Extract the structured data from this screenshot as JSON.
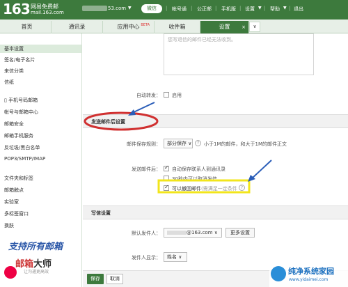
{
  "header": {
    "logo_number": "163",
    "logo_text1": "网易免费邮",
    "logo_text2": "mail.163.com",
    "email_suffix": "53.com",
    "wechat_label": "微信",
    "links": [
      "帐号通",
      "公正邮",
      "手机版",
      "设置",
      "帮助",
      "退出"
    ]
  },
  "tabs": [
    {
      "label": "首页"
    },
    {
      "label": "通讯录"
    },
    {
      "label": "应用中心",
      "badge": "BETA"
    },
    {
      "label": "收件箱"
    },
    {
      "label": "设置",
      "close": "×"
    }
  ],
  "sidebar": {
    "items": [
      "基本设置",
      "签名/电子名片",
      "来信分类",
      "信纸",
      "手机号码邮箱",
      "帐号与邮箱中心",
      "邮箱安全",
      "邮箱手机服务",
      "反垃圾/黑白名单",
      "POP3/SMTP/IMAP",
      "文件夹和标签",
      "邮箱触点",
      "实验室",
      "多标签窗口",
      "换肤"
    ],
    "promo_line1": "支持所有邮箱",
    "promo_line2a": "邮箱",
    "promo_line2b": "大师",
    "promo_line3": "让沟通更高效"
  },
  "main": {
    "textarea_placeholder": "您写退信的邮件已经无法收到。",
    "auto_forward_label": "自动转发：",
    "auto_forward_option": "启用",
    "section_after_send": "发送邮件后设置",
    "save_rule_label": "邮件保存规则：",
    "save_rule_value": "部分保存",
    "save_rule_note": "小于1M的邮件，和大于1M的邮件正文",
    "after_send_label": "发送邮件后：",
    "opt_save_contacts": "自动保存联系人到通讯录",
    "opt_undo_send": "30秒内可以取消发信",
    "opt_recall": "可以撤回邮件",
    "opt_recall_note": "(需满足一定条件",
    "section_compose": "写信设置",
    "default_sender_label": "默认发件人：",
    "default_sender_value": "@163.com",
    "more_settings": "更多设置",
    "sender_display_label": "发件人显示：",
    "sender_display_value": "姓名"
  },
  "buttons": {
    "save": "保存",
    "cancel": "取消"
  },
  "watermark": {
    "title": "纯净系统家园",
    "url": "www.yidaimei.com"
  },
  "colors": {
    "brand_green": "#3d7a3d",
    "annotation_red": "#d03030",
    "annotation_blue": "#2a5db8",
    "highlight_yellow": "#f2e51c"
  }
}
